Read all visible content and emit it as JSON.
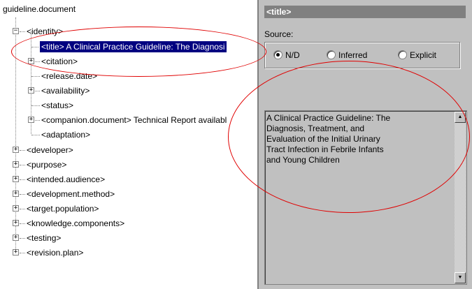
{
  "tree": {
    "root": "guideline.document",
    "items": [
      {
        "label": "<identity>",
        "expander": "-"
      },
      {
        "label": "<title> A Clinical Practice Guideline:  The Diagnosi",
        "selected": true
      },
      {
        "label": "<citation>",
        "expander": "+"
      },
      {
        "label": "<release.date>"
      },
      {
        "label": "<availability>",
        "expander": "+"
      },
      {
        "label": "<status>"
      },
      {
        "label": "<companion.document> Technical Report availabl",
        "expander": "+"
      },
      {
        "label": "<adaptation>"
      },
      {
        "label": "<developer>",
        "expander": "+"
      },
      {
        "label": "<purpose>",
        "expander": "+"
      },
      {
        "label": "<intended.audience>",
        "expander": "+"
      },
      {
        "label": "<development.method>",
        "expander": "+"
      },
      {
        "label": "<target.population>",
        "expander": "+"
      },
      {
        "label": "<knowledge.components>",
        "expander": "+"
      },
      {
        "label": "<testing>",
        "expander": "+"
      },
      {
        "label": "<revision.plan>",
        "expander": "+"
      }
    ]
  },
  "detail": {
    "header": "<title>",
    "source_label": "Source:",
    "options": [
      {
        "label": "N/D",
        "checked": true
      },
      {
        "label": "Inferred",
        "checked": false
      },
      {
        "label": "Explicit",
        "checked": false
      }
    ],
    "text": "A Clinical Practice Guideline:  The\nDiagnosis, Treatment, and\nEvaluation of the Initial Urinary\nTract Infection in Febrile Infants\nand Young Children",
    "scroll_up_icon": "arrow-up-icon",
    "scroll_down_icon": "arrow-down-icon"
  },
  "colors": {
    "selection": "#000080",
    "panel": "#c0c0c0",
    "header": "#808080",
    "annotation": "#e00000"
  }
}
